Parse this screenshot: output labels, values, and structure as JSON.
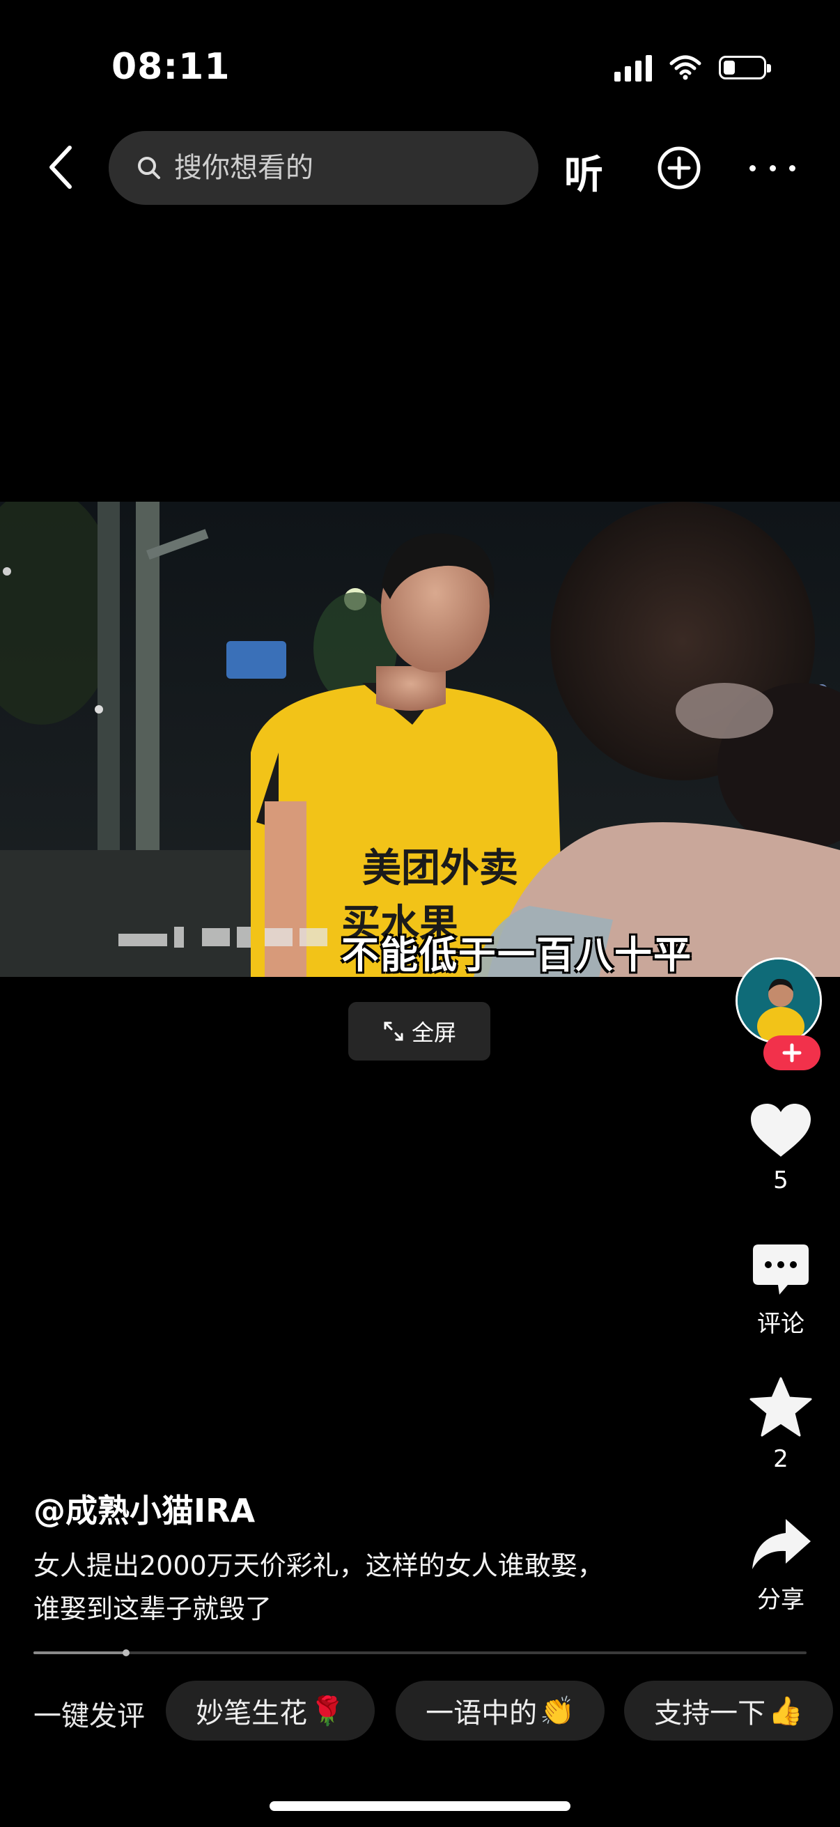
{
  "status_bar": {
    "time": "08:11",
    "battery_level": 0.3
  },
  "nav": {
    "search_placeholder": "搜你想看的",
    "listen_label": "听"
  },
  "video": {
    "subtitle": "不能低于一百八十平",
    "fullscreen_label": "全屏"
  },
  "sidebar": {
    "like_count": "5",
    "comment_label": "评论",
    "favorite_count": "2",
    "share_label": "分享"
  },
  "post": {
    "author": "@成熟小猫IRA",
    "description_line1": "女人提出2000万天价彩礼，这样的女人谁敢娶，",
    "description_line2": "谁娶到这辈子就毁了"
  },
  "playback": {
    "progress": 0.12
  },
  "quick_comment": {
    "label": "一键发评",
    "chips": [
      {
        "text": "妙笔生花",
        "emoji": "🌹"
      },
      {
        "text": "一语中的",
        "emoji": "👏"
      },
      {
        "text": "支持一下",
        "emoji": "👍"
      }
    ]
  },
  "colors": {
    "background": "#000000",
    "accent_red": "#f2314b",
    "shirt_yellow": "#f2c318"
  }
}
